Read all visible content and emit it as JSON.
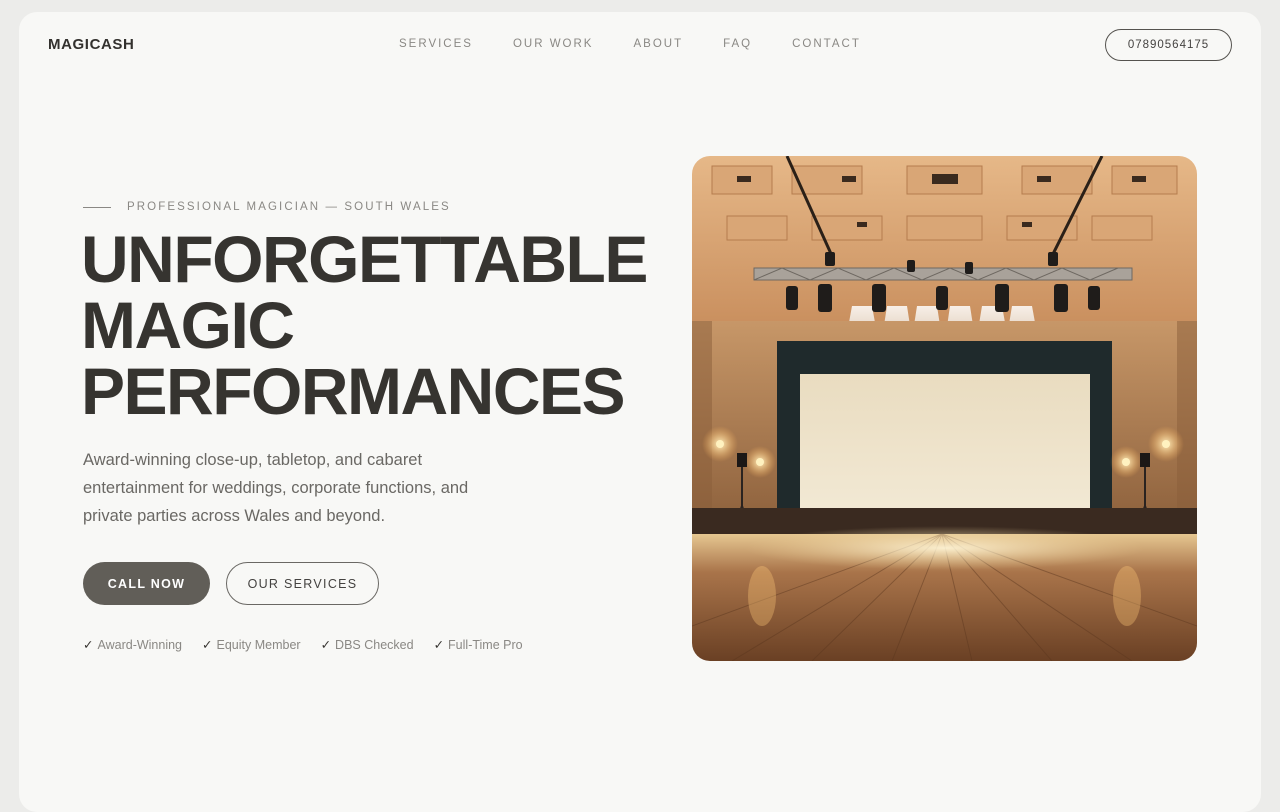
{
  "brand": {
    "name": "MAGICASH"
  },
  "nav": {
    "items": [
      "SERVICES",
      "OUR WORK",
      "ABOUT",
      "FAQ",
      "CONTACT"
    ]
  },
  "header": {
    "phone": "07890564175"
  },
  "hero": {
    "eyebrow": "PROFESSIONAL MAGICIAN — SOUTH WALES",
    "headline": [
      "UNFORGETTABLE",
      "MAGIC",
      "PERFORMANCES"
    ],
    "lead": "Award-winning close-up, tabletop, and cabaret entertainment for weddings, corporate functions, and private parties across Wales and beyond.",
    "primary_cta": "CALL NOW",
    "secondary_cta": "OUR SERVICES",
    "badges": [
      "Award-Winning",
      "Equity Member",
      "DBS Checked",
      "Full-Time Pro"
    ],
    "badge_icon": "✓",
    "image": {
      "icon": "stage-photo",
      "subject": "empty ballroom stage with spotlights"
    }
  },
  "colors": {
    "text_dark": "#363430",
    "text_muted": "#8a8884",
    "primary_button": "#615e58",
    "background": "#f8f8f6"
  }
}
